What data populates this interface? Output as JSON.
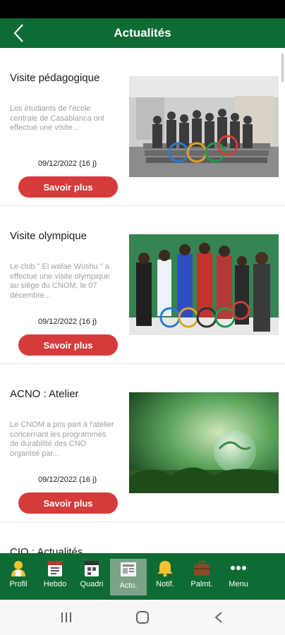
{
  "header": {
    "title": "Actualités"
  },
  "articles": [
    {
      "title": "Visite pédagogique",
      "description": "Les étudiants de l'école centrale de Casablanca ont effectué une visite...",
      "date": "09/12/2022 (16 j)",
      "button_label": "Savoir plus"
    },
    {
      "title": "Visite olympique",
      "description": "Le club \" El wafae Wushu \" a effectué une visite olympique au siège du CNOM, le 07 décembre...",
      "date": "09/12/2022 (16 j)",
      "button_label": "Savoir plus"
    },
    {
      "title": "ACNO : Atelier",
      "description": "Le CNOM a pris part à l'atelier concernant les programmes de durabilité des CNO organisé par...",
      "date": "09/12/2022 (16 j)",
      "button_label": "Savoir plus"
    },
    {
      "title": "CIO : Actualités"
    }
  ],
  "bottom_nav": [
    {
      "label": "Profil",
      "icon": "user-icon"
    },
    {
      "label": "Hebdo",
      "icon": "calendar-week-icon"
    },
    {
      "label": "Quadri",
      "icon": "calendar-quad-icon"
    },
    {
      "label": "Actu.",
      "icon": "news-icon",
      "active": true
    },
    {
      "label": "Notif.",
      "icon": "bell-icon"
    },
    {
      "label": "Palmt.",
      "icon": "briefcase-icon"
    },
    {
      "label": "Menu",
      "icon": "more-dots-icon"
    }
  ],
  "colors": {
    "primary": "#0f6b34",
    "accent": "#d63b3b",
    "active_tab": "#7aa387"
  }
}
